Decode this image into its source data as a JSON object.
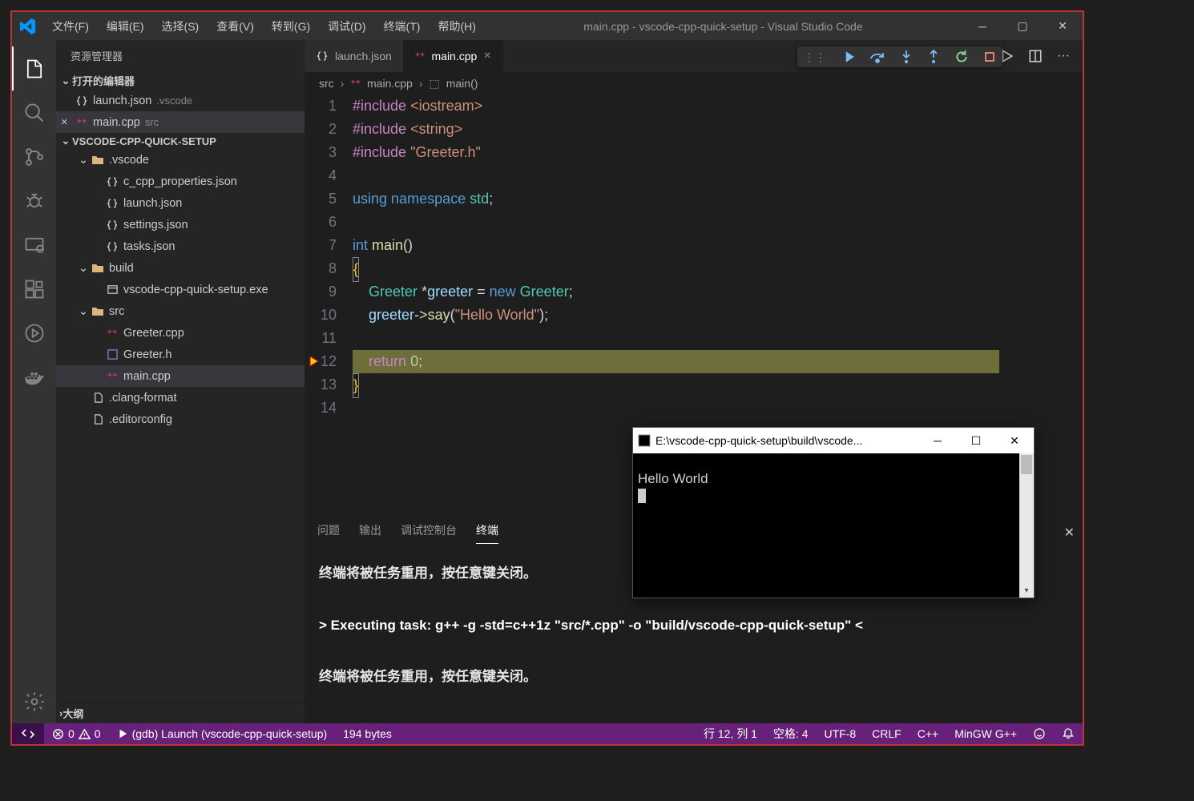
{
  "title": "main.cpp - vscode-cpp-quick-setup - Visual Studio Code",
  "menu": [
    "文件(F)",
    "编辑(E)",
    "选择(S)",
    "查看(V)",
    "转到(G)",
    "调试(D)",
    "终端(T)",
    "帮助(H)"
  ],
  "sidebar_title": "资源管理器",
  "open_editors_label": "打开的编辑器",
  "open_editors": [
    {
      "name": "launch.json",
      "meta": ".vscode",
      "icon": "json"
    },
    {
      "name": "main.cpp",
      "meta": "src",
      "icon": "cpp",
      "active": true,
      "close": "×"
    }
  ],
  "workspace_name": "VSCODE-CPP-QUICK-SETUP",
  "tree": [
    {
      "d": 1,
      "tw": "v",
      "folder": true,
      "name": ".vscode"
    },
    {
      "d": 2,
      "icon": "json",
      "name": "c_cpp_properties.json"
    },
    {
      "d": 2,
      "icon": "json",
      "name": "launch.json"
    },
    {
      "d": 2,
      "icon": "json",
      "name": "settings.json"
    },
    {
      "d": 2,
      "icon": "json",
      "name": "tasks.json"
    },
    {
      "d": 1,
      "tw": "v",
      "folder": true,
      "name": "build"
    },
    {
      "d": 2,
      "icon": "exe",
      "name": "vscode-cpp-quick-setup.exe"
    },
    {
      "d": 1,
      "tw": "v",
      "folder": true,
      "name": "src"
    },
    {
      "d": 2,
      "icon": "cpp",
      "name": "Greeter.cpp"
    },
    {
      "d": 2,
      "icon": "h",
      "name": "Greeter.h"
    },
    {
      "d": 2,
      "icon": "cpp",
      "name": "main.cpp",
      "active": true
    },
    {
      "d": 1,
      "icon": "file",
      "name": ".clang-format"
    },
    {
      "d": 1,
      "icon": "file",
      "name": ".editorconfig"
    }
  ],
  "outline_label": "大纲",
  "tabs": [
    {
      "name": "launch.json",
      "icon": "json"
    },
    {
      "name": "main.cpp",
      "icon": "cpp",
      "active": true,
      "close": "×"
    }
  ],
  "breadcrumb": {
    "parts": [
      "src",
      "main.cpp",
      "main()"
    ]
  },
  "code": {
    "lines": 14,
    "breakpoint_line": 12,
    "highlight_line": 12,
    "src": {
      "l1": "#include <iostream>",
      "l2": "#include <string>",
      "l3": "#include \"Greeter.h\"",
      "l5": "using namespace std;",
      "l7_a": "int",
      "l7_b": " main",
      "l7_c": "()",
      "l8": "{",
      "l9_a": "Greeter",
      "l9_b": " *",
      "l9_c": "greeter",
      "l9_d": " = ",
      "l9_e": "new",
      "l9_f": " Greeter",
      "l9_g": ";",
      "l10_a": "greeter",
      "l10_b": "->",
      "l10_c": "say",
      "l10_d": "(",
      "l10_e": "\"Hello World\"",
      "l10_f": ");",
      "l12_a": "return",
      "l12_b": " 0",
      "l12_c": ";",
      "l13": "}"
    }
  },
  "debug_toolbar_icons": [
    "continue",
    "step-over",
    "step-into",
    "step-out",
    "restart",
    "stop"
  ],
  "panel": {
    "tabs": [
      "问题",
      "输出",
      "调试控制台",
      "终端"
    ],
    "active": "终端",
    "lines": [
      "终端将被任务重用，按任意键关闭。",
      "",
      "> Executing task: g++ -g -std=c++1z \"src/*.cpp\" -o \"build/vscode-cpp-quick-setup\" <",
      "",
      "终端将被任务重用，按任意键关闭。"
    ]
  },
  "statusbar": {
    "errors": "0",
    "warnings": "0",
    "launch": "(gdb) Launch (vscode-cpp-quick-setup)",
    "filesize": "194 bytes",
    "cursor": "行 12, 列 1",
    "indent": "空格: 4",
    "encoding": "UTF-8",
    "eol": "CRLF",
    "lang": "C++",
    "compiler": "MinGW G++"
  },
  "console": {
    "title": "E:\\vscode-cpp-quick-setup\\build\\vscode...",
    "output": "Hello World"
  }
}
